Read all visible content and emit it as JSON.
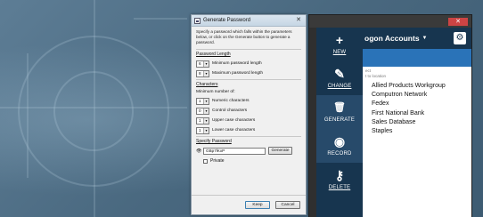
{
  "dialog": {
    "title": "Generate Password",
    "close_glyph": "✕",
    "intro": "Specify a password which falls within the parameters below, or click on the Generate button to generate a password.",
    "length": {
      "heading": "Password Length",
      "rows": [
        {
          "value": "6",
          "label": "Minimum password length"
        },
        {
          "value": "8",
          "label": "Maximum password length"
        }
      ]
    },
    "characters": {
      "heading": "Characters",
      "subheading": "Minimum number of:",
      "rows": [
        {
          "value": "1",
          "label": "Numeric characters"
        },
        {
          "value": "0",
          "label": "Control characters"
        },
        {
          "value": "1",
          "label": "Upper case characters"
        },
        {
          "value": "1",
          "label": "Lower case characters"
        }
      ]
    },
    "specify": {
      "heading": "Specify Password",
      "value": "GBp7lKxP",
      "generate_label": "Generate",
      "private_label": "Private",
      "private_checked": false
    },
    "keep_label": "Keep",
    "cancel_label": "Cancel"
  },
  "app": {
    "close_glyph": "✕",
    "sidebar": [
      {
        "icon": "plus-icon",
        "glyph": "+",
        "label": "NEW"
      },
      {
        "icon": "pencil-icon",
        "glyph": "✎",
        "label": "CHANGE"
      },
      {
        "icon": "trash-icon",
        "glyph": "🗑",
        "label": "GENERATE"
      },
      {
        "icon": "record-icon",
        "glyph": "◉",
        "label": "RECORD"
      },
      {
        "icon": "key-icon",
        "glyph": "⚷",
        "label": "DELETE"
      }
    ],
    "header_title": "ogon Accounts",
    "header_caret": "▼",
    "gear_glyph": "⚙",
    "hint_line1": "ect",
    "hint_line2": "t to location",
    "accounts": [
      "Allied Products Workgroup",
      "Computron Network",
      "Fedex",
      "First National Bank",
      "Sales Database",
      "Staples"
    ]
  },
  "colors": {
    "sidebar": "#17354f",
    "accent_band": "#2a73b8",
    "desktop": "#4f6f86"
  }
}
